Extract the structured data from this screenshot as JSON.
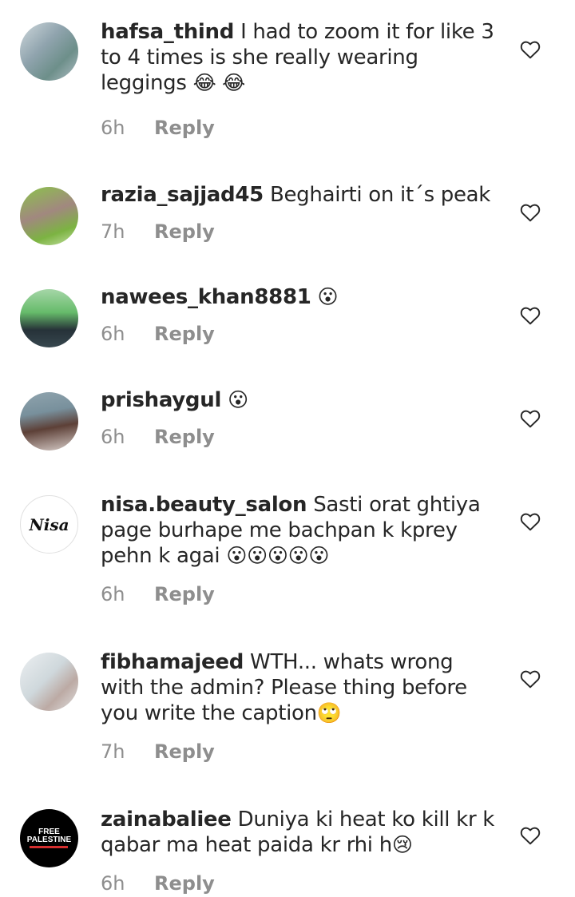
{
  "comments": [
    {
      "username": "hafsa_thind",
      "text": "I had to zoom it for like 3 to 4 times is she really wearing leggings",
      "emoji": "😂 😂",
      "time": "6h",
      "reply": "Reply"
    },
    {
      "username": "razia_sajjad45",
      "text": "Beghairti on it´s peak",
      "emoji": "",
      "time": "7h",
      "reply": "Reply"
    },
    {
      "username": "nawees_khan8881",
      "text": "",
      "emoji": "😮",
      "time": "6h",
      "reply": "Reply"
    },
    {
      "username": "prishaygul",
      "text": "",
      "emoji": "😮",
      "time": "6h",
      "reply": "Reply"
    },
    {
      "username": "nisa.beauty_salon",
      "text": "Sasti orat ghtiya page burhape me bachpan k kprey pehn k agai",
      "emoji": "😮😮😮😮😮",
      "time": "6h",
      "reply": "Reply"
    },
    {
      "username": "fibhamajeed",
      "text": "WTH... whats wrong with the admin? Please thing before you write the caption",
      "emoji": "🙄",
      "time": "7h",
      "reply": "Reply"
    },
    {
      "username": "zainabaliee",
      "text": "Duniya ki heat ko kill kr k qabar ma heat paida kr rhi h",
      "emoji": "😢",
      "time": "6h",
      "reply": "Reply"
    }
  ],
  "avatar_logos": {
    "nisa_salon": "Nisa",
    "free_palestine_line1": "FREE",
    "free_palestine_line2": "PALESTINE"
  },
  "icons": {
    "like": "heart-outline-icon"
  },
  "colors": {
    "text": "#262626",
    "meta": "#8e8e8e",
    "background": "#ffffff"
  }
}
